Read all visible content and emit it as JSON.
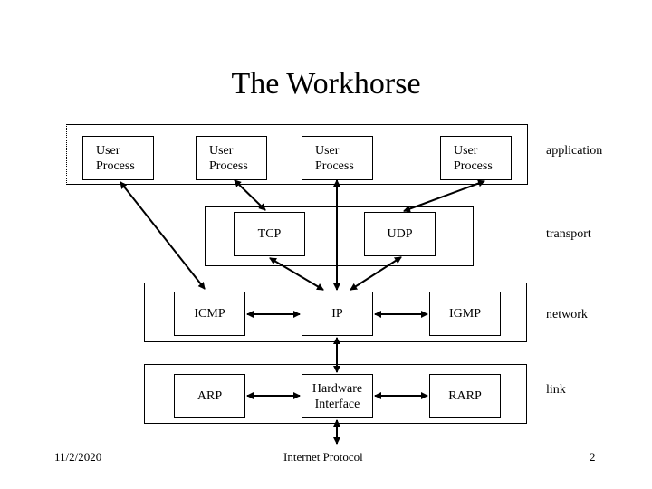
{
  "title": "The Workhorse",
  "layers": {
    "application": "application",
    "transport": "transport",
    "network": "network",
    "link": "link"
  },
  "application": {
    "processes": [
      {
        "line1": "User",
        "line2": "Process"
      },
      {
        "line1": "User",
        "line2": "Process"
      },
      {
        "line1": "User",
        "line2": "Process"
      },
      {
        "line1": "User",
        "line2": "Process"
      }
    ]
  },
  "transport": {
    "tcp": "TCP",
    "udp": "UDP"
  },
  "network": {
    "icmp": "ICMP",
    "ip": "IP",
    "igmp": "IGMP"
  },
  "link": {
    "arp": "ARP",
    "hw_line1": "Hardware",
    "hw_line2": "Interface",
    "rarp": "RARP"
  },
  "footer": {
    "date": "11/2/2020",
    "caption": "Internet Protocol",
    "page": "2"
  }
}
